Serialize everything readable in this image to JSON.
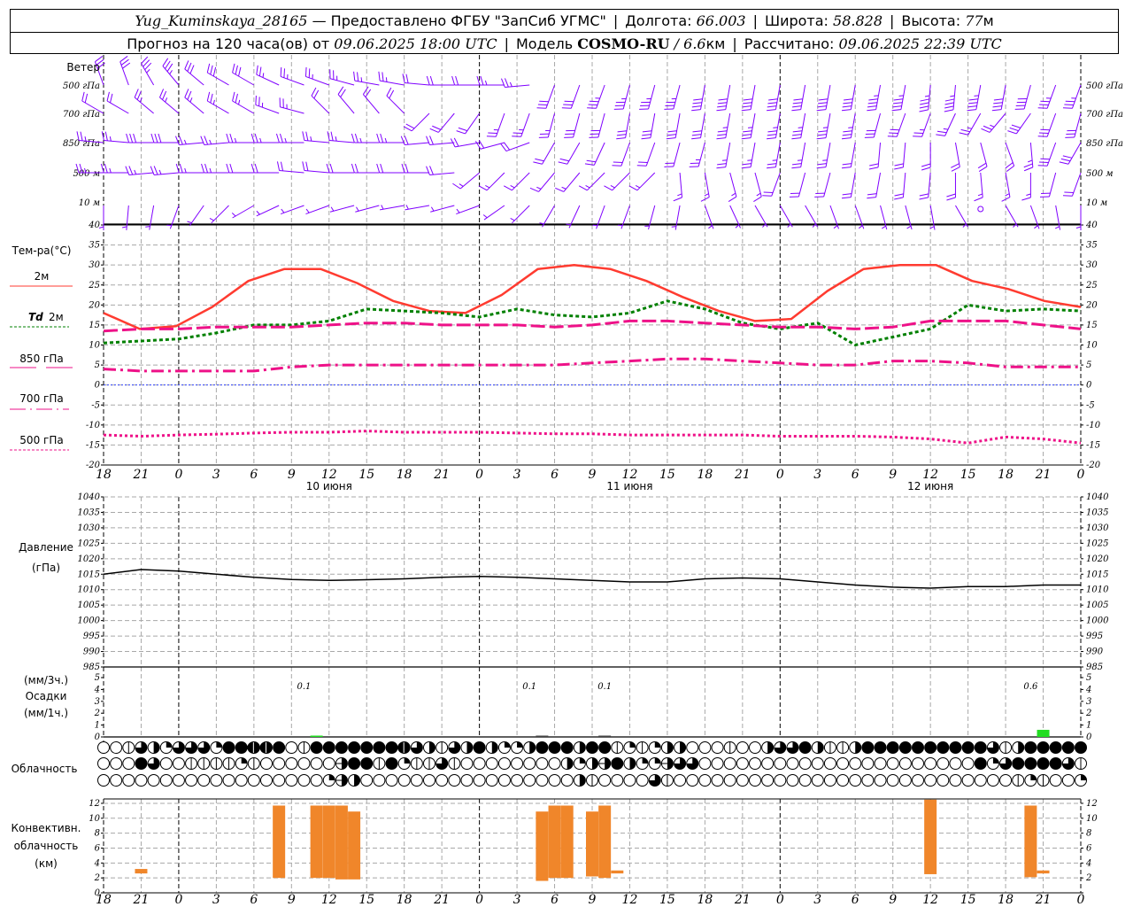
{
  "header": {
    "station": "Yug_Kuminskaya_28165",
    "provider": " — Предоставлено ФГБУ \"ЗапСиб УГМС\"",
    "lon_label": "Долгота: ",
    "lon": "66.003",
    "lat_label": "Широта: ",
    "lat": "58.828",
    "alt_label": "Высота: ",
    "alt": "77",
    "alt_unit": "м",
    "forecast_label": "Прогноз на 120 часа(ов) от ",
    "start_time": "09.06.2025 18:00 UTC",
    "model_label": "Модель ",
    "model": "COSMO-RU",
    "model_sep": " / ",
    "resolution": "6.6",
    "resolution_unit": "км",
    "calc_label": "Рассчитано: ",
    "calc_time": "09.06.2025 22:39 UTC"
  },
  "x_axis": {
    "time_range": [
      "09.06 18:00",
      "13.06 00:00"
    ],
    "ticks": [
      "18",
      "21",
      "0",
      "3",
      "6",
      "9",
      "12",
      "15",
      "18",
      "21",
      "0",
      "3",
      "6",
      "9",
      "12",
      "15",
      "18",
      "21",
      "0",
      "3",
      "6",
      "9",
      "12",
      "15",
      "18",
      "21",
      "0"
    ],
    "dates": [
      "10 июня",
      "11 июня",
      "12 июня"
    ]
  },
  "labels": {
    "wind": "Ветер",
    "levels": [
      "500 гПа",
      "700 гПа",
      "850 гПа",
      "500 м",
      "10 м"
    ],
    "temp_title": "Тем-ра(°C)",
    "t2m": "2м",
    "td_sym": "Td",
    "td_h": "2м",
    "t850": "850 гПа",
    "t700": "700 гПа",
    "t500": "500 гПа",
    "pressure": "Давление",
    "pressure_unit": "(гПа)",
    "precip_3h": "(мм/3ч.)",
    "precip": "Осадки",
    "precip_1h": "(мм/1ч.)",
    "clouds": "Облачность",
    "conv1": "Конвективн.",
    "conv2": "облачность",
    "conv3": "(км)"
  },
  "colors": {
    "wind": "#7f00ff",
    "t2m": "#ff3b30",
    "td": "#008000",
    "upper": "#ee1188",
    "zero": "#3344ff",
    "precip": "#22dd22",
    "conv": "#f0862a",
    "grid": "#a8a8a8"
  },
  "chart_data": [
    {
      "type": "wind-barbs",
      "title": "Ветер",
      "units": "м/с",
      "levels": [
        {
          "name": "500 гПа",
          "dir": [
            340,
            340,
            330,
            320,
            310,
            300,
            300,
            295,
            290,
            290,
            285,
            280,
            280,
            275,
            270,
            270,
            270,
            265,
            200,
            200,
            200,
            195,
            195,
            195,
            190,
            190,
            190,
            190,
            190,
            190,
            190,
            190,
            190,
            185,
            185,
            190,
            190,
            195,
            200,
            200
          ],
          "speed": [
            15,
            15,
            17,
            17,
            15,
            15,
            15,
            12,
            12,
            12,
            12,
            12,
            12,
            10,
            10,
            10,
            12,
            12,
            15,
            15,
            17,
            17,
            17,
            17,
            20,
            20,
            20,
            20,
            20,
            20,
            20,
            22,
            22,
            22,
            22,
            22,
            20,
            20,
            17,
            17
          ]
        },
        {
          "name": "700 гПа",
          "dir": [
            300,
            300,
            310,
            310,
            310,
            300,
            300,
            290,
            285,
            315,
            320,
            320,
            315,
            225,
            220,
            215,
            200,
            200,
            195,
            195,
            195,
            190,
            190,
            190,
            190,
            190,
            190,
            190,
            190,
            190,
            190,
            195,
            200,
            200,
            205,
            210,
            220,
            215,
            200,
            195
          ],
          "speed": [
            10,
            10,
            12,
            12,
            12,
            12,
            12,
            12,
            12,
            10,
            10,
            10,
            10,
            10,
            10,
            10,
            12,
            12,
            12,
            15,
            15,
            15,
            15,
            15,
            15,
            17,
            17,
            17,
            17,
            17,
            17,
            15,
            15,
            12,
            12,
            12,
            12,
            15,
            15,
            15
          ]
        },
        {
          "name": "850 гПа",
          "dir": [
            275,
            275,
            270,
            270,
            265,
            265,
            270,
            270,
            270,
            275,
            275,
            270,
            270,
            265,
            265,
            260,
            255,
            250,
            210,
            210,
            205,
            200,
            200,
            195,
            195,
            190,
            190,
            190,
            190,
            190,
            190,
            185,
            185,
            180,
            170,
            165,
            160,
            175,
            200,
            210
          ],
          "speed": [
            12,
            12,
            15,
            15,
            12,
            12,
            12,
            12,
            12,
            12,
            12,
            12,
            12,
            10,
            10,
            10,
            10,
            10,
            10,
            10,
            10,
            10,
            10,
            10,
            12,
            12,
            12,
            12,
            12,
            12,
            10,
            10,
            10,
            10,
            10,
            10,
            10,
            12,
            15,
            15
          ]
        },
        {
          "name": "500 м",
          "dir": [
            270,
            270,
            265,
            265,
            270,
            270,
            270,
            270,
            275,
            275,
            270,
            270,
            270,
            270,
            265,
            230,
            225,
            225,
            220,
            220,
            225,
            225,
            225,
            175,
            170,
            165,
            165,
            200,
            195,
            195,
            190,
            190,
            185,
            185,
            180,
            175,
            170,
            180,
            195,
            200
          ],
          "speed": [
            12,
            12,
            12,
            12,
            12,
            12,
            10,
            10,
            10,
            10,
            10,
            10,
            10,
            10,
            10,
            7,
            7,
            7,
            7,
            7,
            7,
            7,
            7,
            7,
            7,
            7,
            7,
            10,
            10,
            10,
            10,
            10,
            10,
            10,
            10,
            7,
            7,
            7,
            10,
            10
          ]
        },
        {
          "name": "10 м",
          "dir": [
            180,
            185,
            190,
            200,
            215,
            225,
            240,
            245,
            250,
            250,
            255,
            255,
            260,
            260,
            255,
            250,
            235,
            225,
            210,
            205,
            200,
            200,
            195,
            190,
            160,
            155,
            150,
            150,
            150,
            160,
            160,
            165,
            165,
            170,
            150,
            0,
            150,
            160,
            170,
            180
          ],
          "speed": [
            2,
            3,
            3,
            3,
            3,
            3,
            3,
            4,
            4,
            4,
            4,
            4,
            4,
            4,
            3,
            3,
            3,
            3,
            3,
            3,
            3,
            3,
            3,
            3,
            3,
            3,
            3,
            3,
            3,
            3,
            3,
            3,
            3,
            3,
            2,
            0,
            2,
            3,
            3,
            3
          ]
        }
      ]
    },
    {
      "type": "line",
      "title": "Тем-ра(°C)",
      "ylim": [
        -20,
        40
      ],
      "yticks": [
        -20,
        -15,
        -10,
        -5,
        0,
        5,
        10,
        15,
        20,
        25,
        30,
        35,
        40
      ],
      "grid": true,
      "legend": "left",
      "series": [
        {
          "name": "2м",
          "style": "solid",
          "values": [
            18,
            14,
            14.7,
            19.5,
            26,
            29,
            29,
            25.5,
            21,
            18.5,
            18,
            22.5,
            29,
            30,
            29,
            26,
            22,
            18.5,
            16,
            16.5,
            23.5,
            29,
            30,
            30,
            26,
            24,
            21,
            19.5
          ]
        },
        {
          "name": "Td 2м",
          "style": "dotted",
          "values": [
            10.5,
            11,
            11.5,
            13,
            15,
            15,
            16,
            19,
            18.5,
            18,
            17,
            19,
            17.5,
            17,
            18,
            21,
            19,
            15.5,
            14,
            15.5,
            10,
            12,
            14,
            20,
            18.5,
            19,
            18.5
          ]
        },
        {
          "name": "850 гПа",
          "style": "long-dash",
          "values": [
            13.5,
            14,
            14,
            14.5,
            14.5,
            14.5,
            15,
            15.5,
            15.5,
            15,
            15,
            15,
            14.5,
            15,
            16,
            16,
            15.5,
            15,
            14.5,
            14.5,
            14,
            14.5,
            16,
            16,
            16,
            15,
            14
          ]
        },
        {
          "name": "700 гПа",
          "style": "dash-dot",
          "values": [
            4,
            3.5,
            3.5,
            3.5,
            3.5,
            4.5,
            5,
            5,
            5,
            5,
            5,
            5,
            5,
            5.5,
            6,
            6.5,
            6.5,
            6,
            5.5,
            5,
            5,
            6,
            6,
            5.5,
            4.5,
            4.5,
            4.5
          ]
        },
        {
          "name": "500 гПа",
          "style": "dotted",
          "values": [
            -12.5,
            -12.8,
            -12.5,
            -12.3,
            -12,
            -11.8,
            -11.8,
            -11.5,
            -11.8,
            -11.8,
            -11.8,
            -12,
            -12.2,
            -12.2,
            -12.5,
            -12.5,
            -12.5,
            -12.5,
            -12.8,
            -12.8,
            -12.8,
            -13,
            -13.5,
            -14.5,
            -13,
            -13.5,
            -14.5
          ]
        }
      ]
    },
    {
      "type": "line",
      "title": "Давление (гПа)",
      "ylim": [
        985,
        1040
      ],
      "yticks": [
        985,
        990,
        995,
        1000,
        1005,
        1010,
        1015,
        1020,
        1025,
        1030,
        1035,
        1040
      ],
      "values": [
        1015,
        1016.5,
        1016,
        1015,
        1014,
        1013.3,
        1013,
        1013.2,
        1013.5,
        1014,
        1014.3,
        1014,
        1013.5,
        1013,
        1012.5,
        1012.5,
        1013.5,
        1013.8,
        1013.5,
        1012.5,
        1011.5,
        1010.8,
        1010.5,
        1011,
        1011,
        1011.5,
        1011.5
      ]
    },
    {
      "type": "bar",
      "title": "Осадки",
      "ylim": [
        0,
        5
      ],
      "yticks": [
        0,
        1,
        2,
        3,
        4,
        5
      ],
      "hourly": [
        {
          "time": "10.06 11",
          "value": 0.1
        },
        {
          "time": "11.06 05",
          "value": 0.05
        },
        {
          "time": "11.06 10",
          "value": 0.05
        },
        {
          "time": "12.06 21",
          "value": 0.6
        }
      ],
      "sums_3h": [
        {
          "time": "10.06 10",
          "label": "0.1"
        },
        {
          "time": "11.06 04",
          "label": "0.1"
        },
        {
          "time": "11.06 10",
          "label": "0.1"
        },
        {
          "time": "12.06 20",
          "label": "0.6"
        }
      ]
    },
    {
      "type": "symbols",
      "title": "Облачность",
      "rows": [
        "0016426662887780188888887641648422488848812124400010046684114888888888861488888",
        "0008600111121000000988182116100000000424984229660000000000000000000000826888861",
        "0000000000000000002940000000000000000041000061000000000000000000000000000121002"
      ]
    },
    {
      "type": "bar",
      "title": "Конвективн. облачность (км)",
      "ylim": [
        0,
        12.7
      ],
      "yticks": [
        0,
        2,
        4,
        6,
        8,
        10,
        12
      ],
      "bars": [
        {
          "time": "09.06 21",
          "base": 2.6,
          "top": 3.2
        },
        {
          "time": "10.06 08",
          "base": 2.0,
          "top": 11.7
        },
        {
          "time": "10.06 11",
          "base": 2.0,
          "top": 11.7
        },
        {
          "time": "10.06 12",
          "base": 2.0,
          "top": 11.7
        },
        {
          "time": "10.06 13",
          "base": 1.8,
          "top": 11.7
        },
        {
          "time": "10.06 14",
          "base": 1.8,
          "top": 10.9
        },
        {
          "time": "11.06 05",
          "base": 1.6,
          "top": 10.9
        },
        {
          "time": "11.06 06",
          "base": 2.0,
          "top": 11.7
        },
        {
          "time": "11.06 07",
          "base": 2.0,
          "top": 11.7
        },
        {
          "time": "11.06 09",
          "base": 2.2,
          "top": 10.9
        },
        {
          "time": "11.06 10",
          "base": 2.0,
          "top": 11.7
        },
        {
          "time": "11.06 11",
          "base": 2.6,
          "top": 3.0
        },
        {
          "time": "12.06 12",
          "base": 2.5,
          "top": 12.5
        },
        {
          "time": "12.06 20",
          "base": 2.1,
          "top": 11.7
        },
        {
          "time": "12.06 21",
          "base": 2.6,
          "top": 3.0
        }
      ]
    }
  ]
}
